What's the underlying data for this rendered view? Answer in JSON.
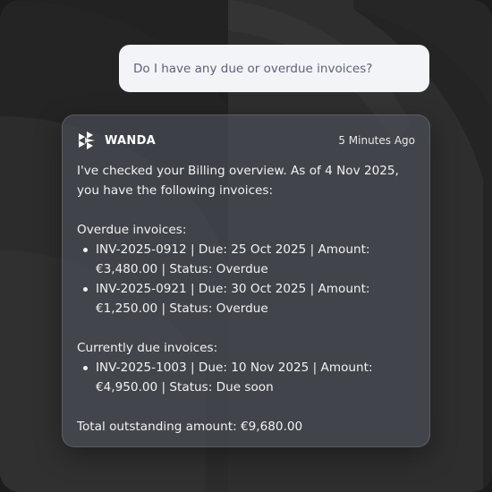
{
  "user_message": "Do I have any due or overdue invoices?",
  "assistant": {
    "name": "WANDA",
    "logo_icon": "wanda-logo-icon",
    "timestamp": "5 Minutes Ago",
    "intro": "I've checked your Billing overview. As of 4 Nov 2025, you have the following invoices:",
    "overdue_heading": "Overdue invoices:",
    "overdue_items": [
      "INV-2025-0912 | Due: 25 Oct 2025 | Amount: €3,480.00 | Status: Overdue",
      "INV-2025-0921 | Due: 30 Oct 2025 | Amount: €1,250.00 | Status: Overdue"
    ],
    "due_heading": "Currently due invoices:",
    "due_items": [
      "INV-2025-1003 | Due: 10 Nov 2025 | Amount: €4,950.00 | Status: Due soon"
    ],
    "total": "Total outstanding amount: €9,680.00"
  },
  "colors": {
    "background": "#242424",
    "user_bubble": "#f3f4f8",
    "user_text": "#5a6478",
    "card_text": "#f2f2f2"
  }
}
